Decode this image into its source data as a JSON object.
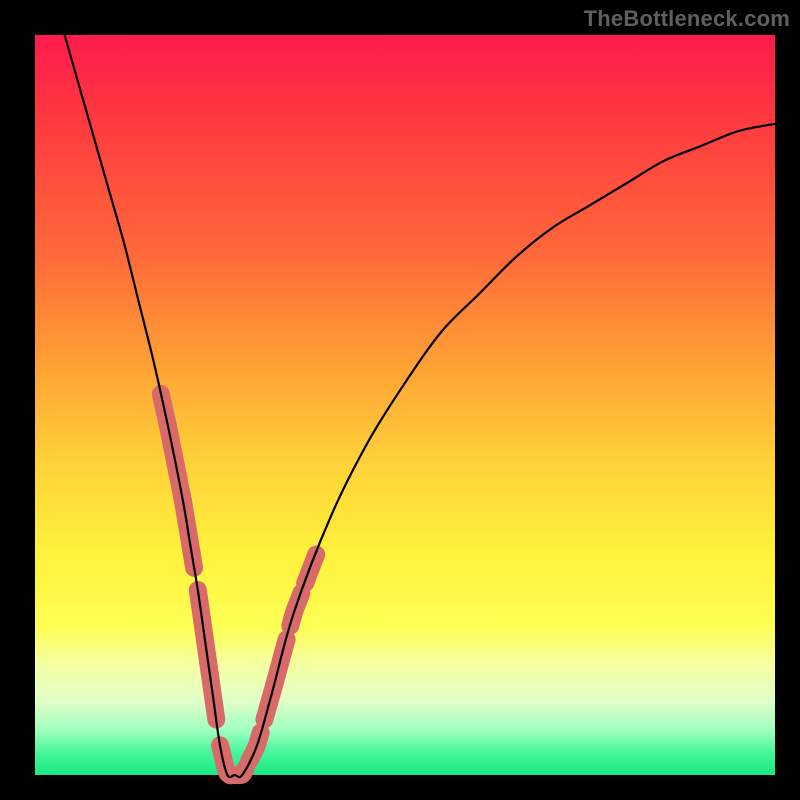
{
  "watermark": "TheBottleneck.com",
  "colors": {
    "frame": "#000000",
    "curve": "#000000",
    "highlight": "#d86a6a",
    "gradient_top": "#ff1a4d",
    "gradient_bottom": "#18e884"
  },
  "chart_data": {
    "type": "line",
    "title": "",
    "xlabel": "",
    "ylabel": "",
    "xlim": [
      0,
      100
    ],
    "ylim": [
      0,
      100
    ],
    "grid": false,
    "series": [
      {
        "name": "bottleneck-curve",
        "x": [
          4,
          6,
          8,
          10,
          12,
          14,
          16,
          18,
          20,
          21,
          22,
          23,
          24,
          25,
          26,
          27,
          28,
          30,
          32,
          35,
          40,
          45,
          50,
          55,
          60,
          65,
          70,
          75,
          80,
          85,
          90,
          95,
          100
        ],
        "y": [
          100,
          93,
          86,
          79,
          72,
          64,
          56,
          47,
          37,
          31,
          25,
          18,
          11,
          4,
          0,
          0,
          0,
          4,
          11,
          22,
          35,
          45,
          53,
          60,
          65,
          70,
          74,
          77,
          80,
          83,
          85,
          87,
          88
        ]
      }
    ],
    "highlighted_segments": [
      {
        "side": "left",
        "x_range": [
          17,
          19
        ],
        "note": "pink marker on descending branch"
      },
      {
        "side": "left",
        "x_range": [
          19,
          20
        ],
        "note": "pink marker on descending branch"
      },
      {
        "side": "left",
        "x_range": [
          20,
          21.5
        ],
        "note": "pink marker on descending branch"
      },
      {
        "side": "left",
        "x_range": [
          22,
          23.5
        ],
        "note": "pink marker on descending branch"
      },
      {
        "side": "left",
        "x_range": [
          23.5,
          24.5
        ],
        "note": "pink marker on descending branch"
      },
      {
        "side": "trough",
        "x_range": [
          25,
          28.5
        ],
        "note": "pink band at trough"
      },
      {
        "side": "right",
        "x_range": [
          29,
          30.5
        ],
        "note": "pink marker on ascending branch"
      },
      {
        "side": "right",
        "x_range": [
          31,
          32.5
        ],
        "note": "pink marker on ascending branch"
      },
      {
        "side": "right",
        "x_range": [
          32.5,
          34
        ],
        "note": "pink marker on ascending branch"
      },
      {
        "side": "right",
        "x_range": [
          34.5,
          36
        ],
        "note": "pink marker on ascending branch"
      },
      {
        "side": "right",
        "x_range": [
          36.5,
          38
        ],
        "note": "pink marker on ascending branch"
      }
    ]
  }
}
